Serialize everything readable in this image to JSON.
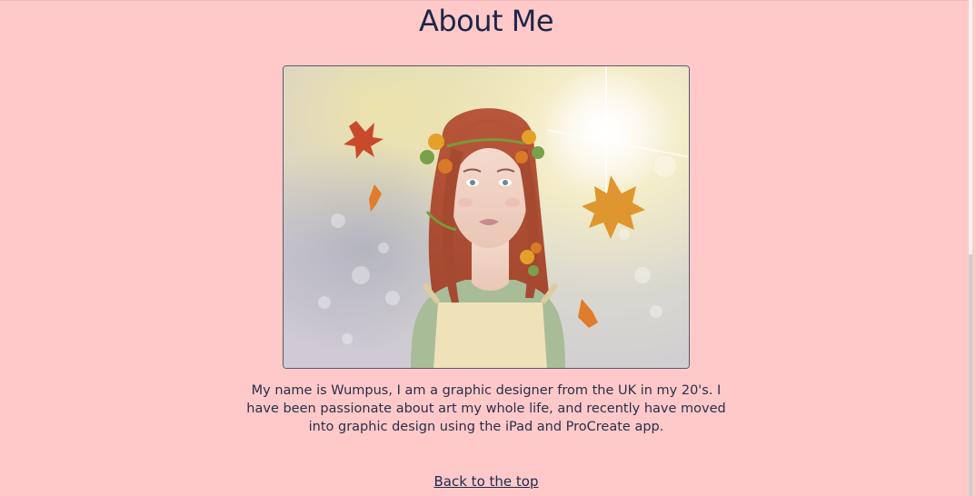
{
  "about": {
    "heading": "About Me",
    "bio": "My name is Wumpus, I am a graphic designer from the UK in my 20's. I have been passionate about art my whole life, and recently have moved into graphic design using the iPad and ProCreate app.",
    "back_to_top": "Back to the top"
  },
  "colors": {
    "background": "#ffc9c9",
    "heading": "#1c2748",
    "text": "#2a2f4a"
  },
  "image": {
    "icon": "portrait-illustration"
  }
}
